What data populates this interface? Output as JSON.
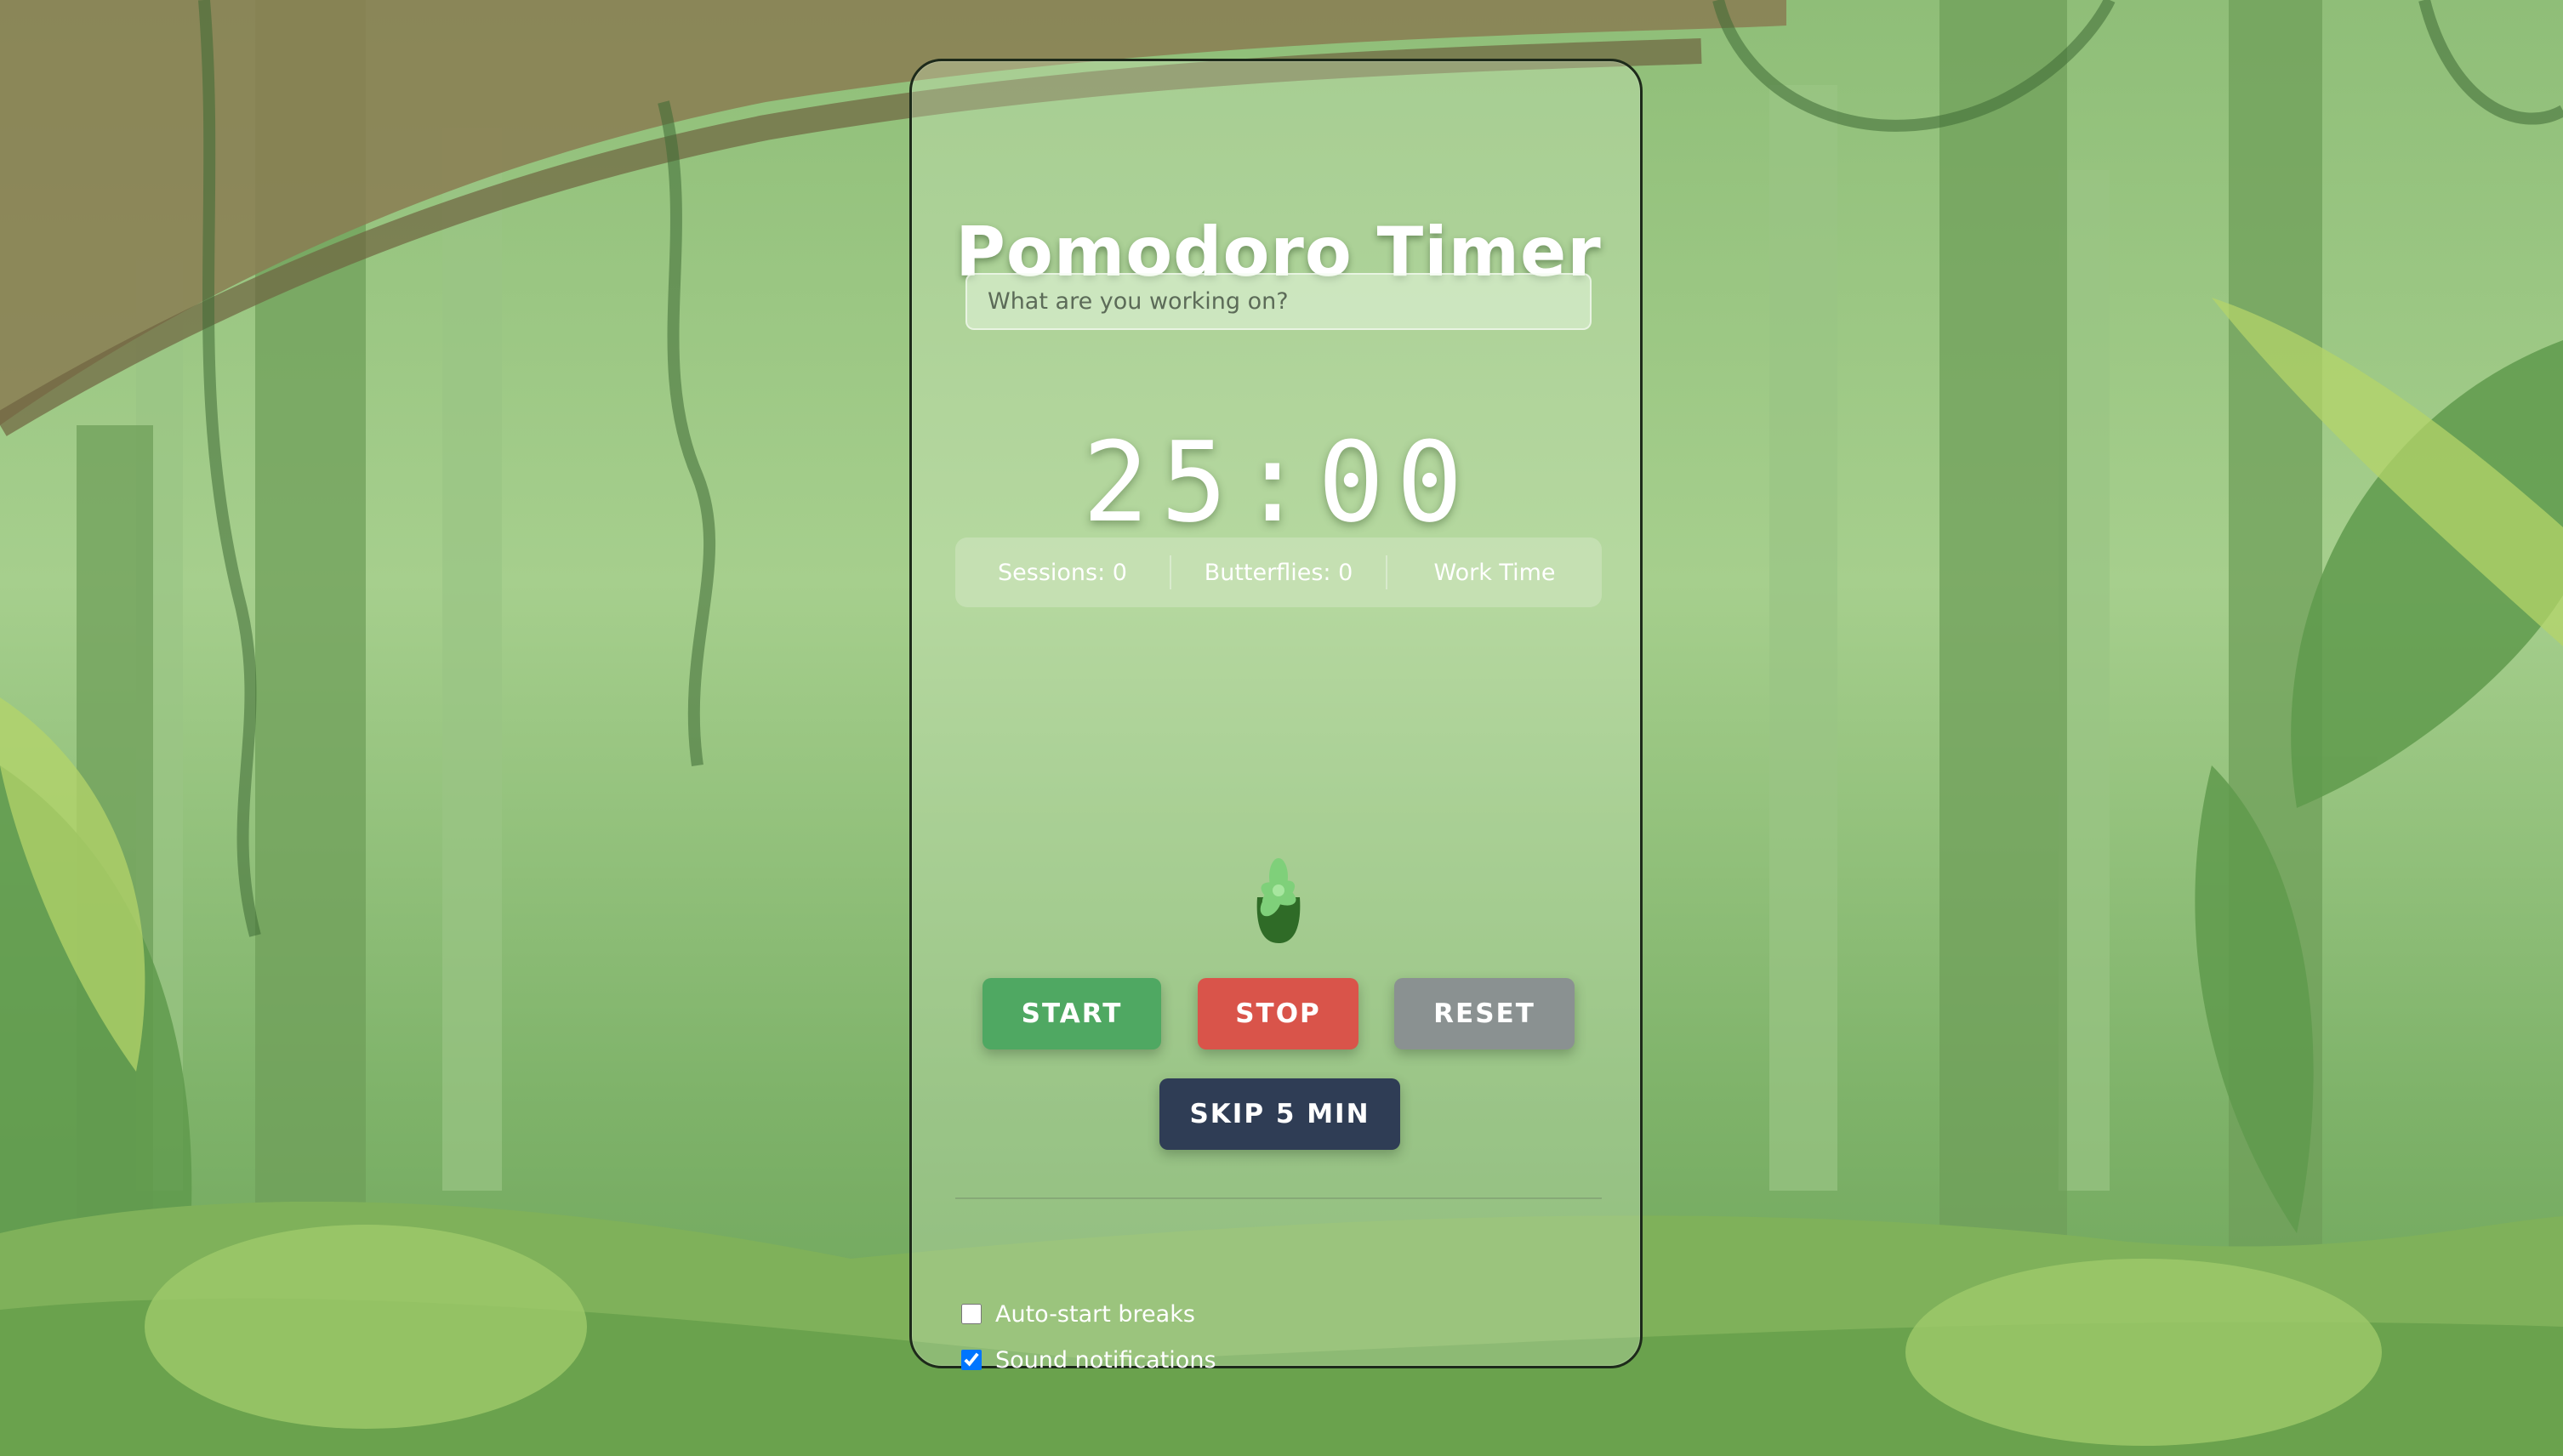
{
  "app": {
    "title": "Pomodoro Timer"
  },
  "task": {
    "placeholder": "What are you working on?",
    "value": ""
  },
  "timer": {
    "display": "25:00"
  },
  "stats": {
    "sessions": "Sessions: 0",
    "butterflies": "Butterflies: 0",
    "mode": "Work Time"
  },
  "controls": {
    "start_label": "START",
    "stop_label": "STOP",
    "reset_label": "RESET",
    "skip_label": "SKIP 5 MIN"
  },
  "options": {
    "auto_start_breaks": {
      "label": "Auto-start breaks",
      "checked": false
    },
    "sound_notifications": {
      "label": "Sound notifications",
      "checked": true
    }
  },
  "colors": {
    "start": "#4fa862",
    "stop": "#d9544a",
    "reset": "#8a9191",
    "skip": "#2f3d55",
    "jungle": "#7fb36a"
  },
  "icons": {
    "plant": "sprout-icon"
  }
}
